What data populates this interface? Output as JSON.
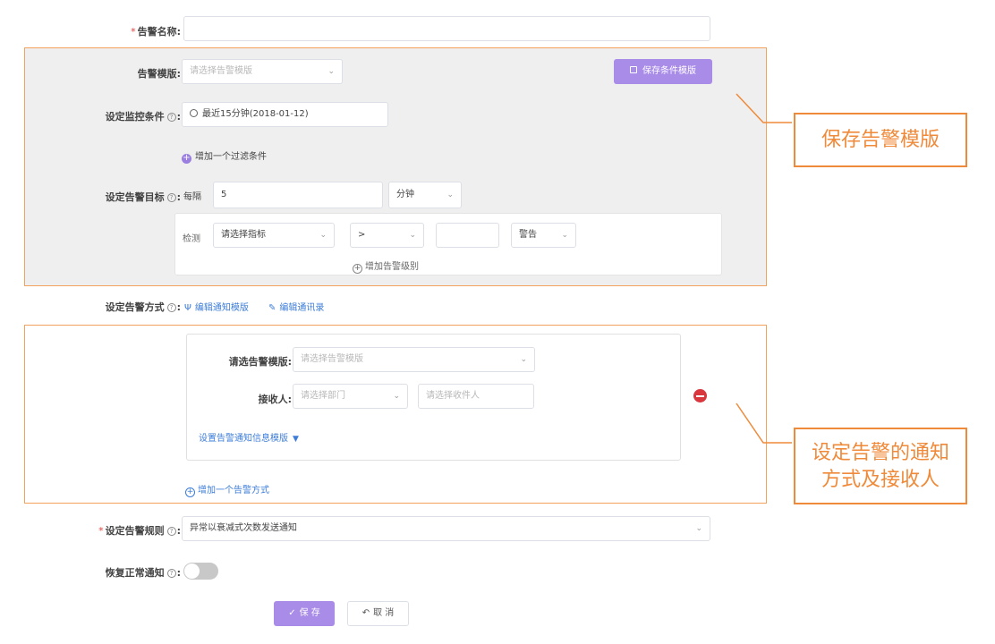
{
  "alert_name": {
    "label": "告警名称:",
    "value": ""
  },
  "template": {
    "label": "告警模版:",
    "placeholder": "请选择告警模版",
    "save_button": "保存条件模版"
  },
  "monitor": {
    "label": "设定监控条件",
    "colon": ":",
    "time_value": "最近15分钟(2018-01-12)",
    "add_filter": "增加一个过滤条件"
  },
  "target": {
    "label": "设定告警目标",
    "colon": ":",
    "every_label": "每隔",
    "interval_value": "5",
    "unit_value": "分钟",
    "detect_label": "检测",
    "metric_placeholder": "请选择指标",
    "operator_value": ">",
    "threshold_value": "",
    "level_value": "警告",
    "add_level": "增加告警级别"
  },
  "notify": {
    "label": "设定告警方式",
    "colon": ":",
    "edit_template_link": "编辑通知模版",
    "edit_contacts_link": "编辑通讯录",
    "template_label": "请选告警模版:",
    "template_placeholder": "请选择告警模版",
    "receiver_label": "接收人:",
    "dept_placeholder": "请选择部门",
    "receiver_placeholder": "请选择收件人",
    "info_template_link": "设置告警通知信息模版",
    "add_method": "增加一个告警方式"
  },
  "rule": {
    "label": "设定告警规则",
    "colon": ":",
    "value": "异常以衰减式次数发送通知"
  },
  "recovery": {
    "label": "恢复正常通知",
    "colon": ":",
    "enabled": false
  },
  "actions": {
    "save": "保 存",
    "cancel": "取 消"
  },
  "callouts": {
    "save_template": "保存告警模版",
    "notify_line1": "设定告警的通知",
    "notify_line2": "方式及接收人"
  },
  "colors": {
    "accent": "#a98be8",
    "callout": "#ef8a3a",
    "link": "#3d7dd8",
    "danger": "#d9363e"
  },
  "icons": {
    "clock": "clock-icon",
    "save": "floppy-icon",
    "edit": "edit-icon",
    "remove": "minus-circle-icon"
  }
}
